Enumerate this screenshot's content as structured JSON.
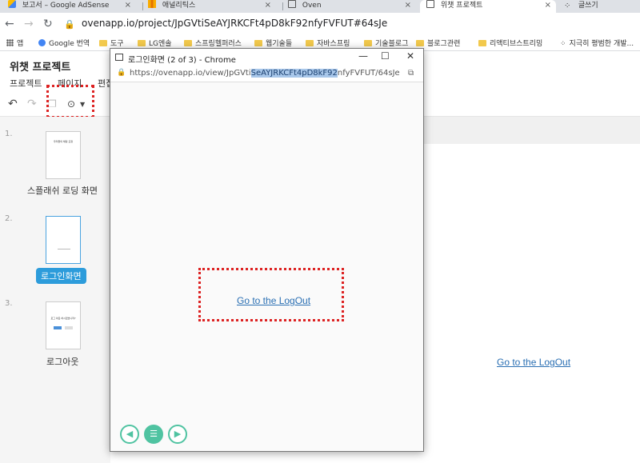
{
  "browser": {
    "tabs": [
      {
        "label": "보고서 – Google AdSense",
        "active": false
      },
      {
        "label": "애널리틱스",
        "active": false
      },
      {
        "label": "Oven",
        "active": false
      },
      {
        "label": "위챗 프로젝트",
        "active": true
      },
      {
        "label": "글쓰기",
        "active": false
      }
    ],
    "tab_close": "×",
    "url": "ovenapp.io/project/JpGVtiSeAYJRKCFt4pD8kF92nfyFVFUT#64sJe",
    "bookmarks": [
      "앱",
      "Google 번역",
      "도구",
      "LG엔솔",
      "스프링헬퍼러스",
      "웹기술들",
      "자바스프링",
      "기술블로그",
      "블로그관련",
      "리액티브스트리밍",
      "지극히 평범한 개발..."
    ]
  },
  "app": {
    "title": "위챗 프로젝트",
    "menu": [
      "프로젝트",
      "페이지",
      "편집"
    ],
    "pages": [
      {
        "num": "1.",
        "label": "스플래쉬 로딩 화면",
        "thumb_text": "우리들의 채팅 요정"
      },
      {
        "num": "2.",
        "label": "로그인화면",
        "selected": true
      },
      {
        "num": "3.",
        "label": "로그아웃",
        "thumb_text": "로그 아웃 하시겠습니까?"
      }
    ],
    "canvas_link": "Go to the LogOut"
  },
  "popup": {
    "title": "로그인화면 (2 of 3) - Chrome",
    "url_prefix": "https://ovenapp.io/view/JpGVti",
    "url_highlight": "SeAYJRKCFt4pD8kF92",
    "url_suffix": "nfyFVFUT/64sJe",
    "link": "Go to the LogOut",
    "minimize": "—",
    "maximize": "☐",
    "close": "✕"
  },
  "colors": {
    "accent": "#2d9cdb",
    "nav_green": "#4fc3a1",
    "highlight_box": "#dd2222",
    "link": "#2a6fb3"
  }
}
